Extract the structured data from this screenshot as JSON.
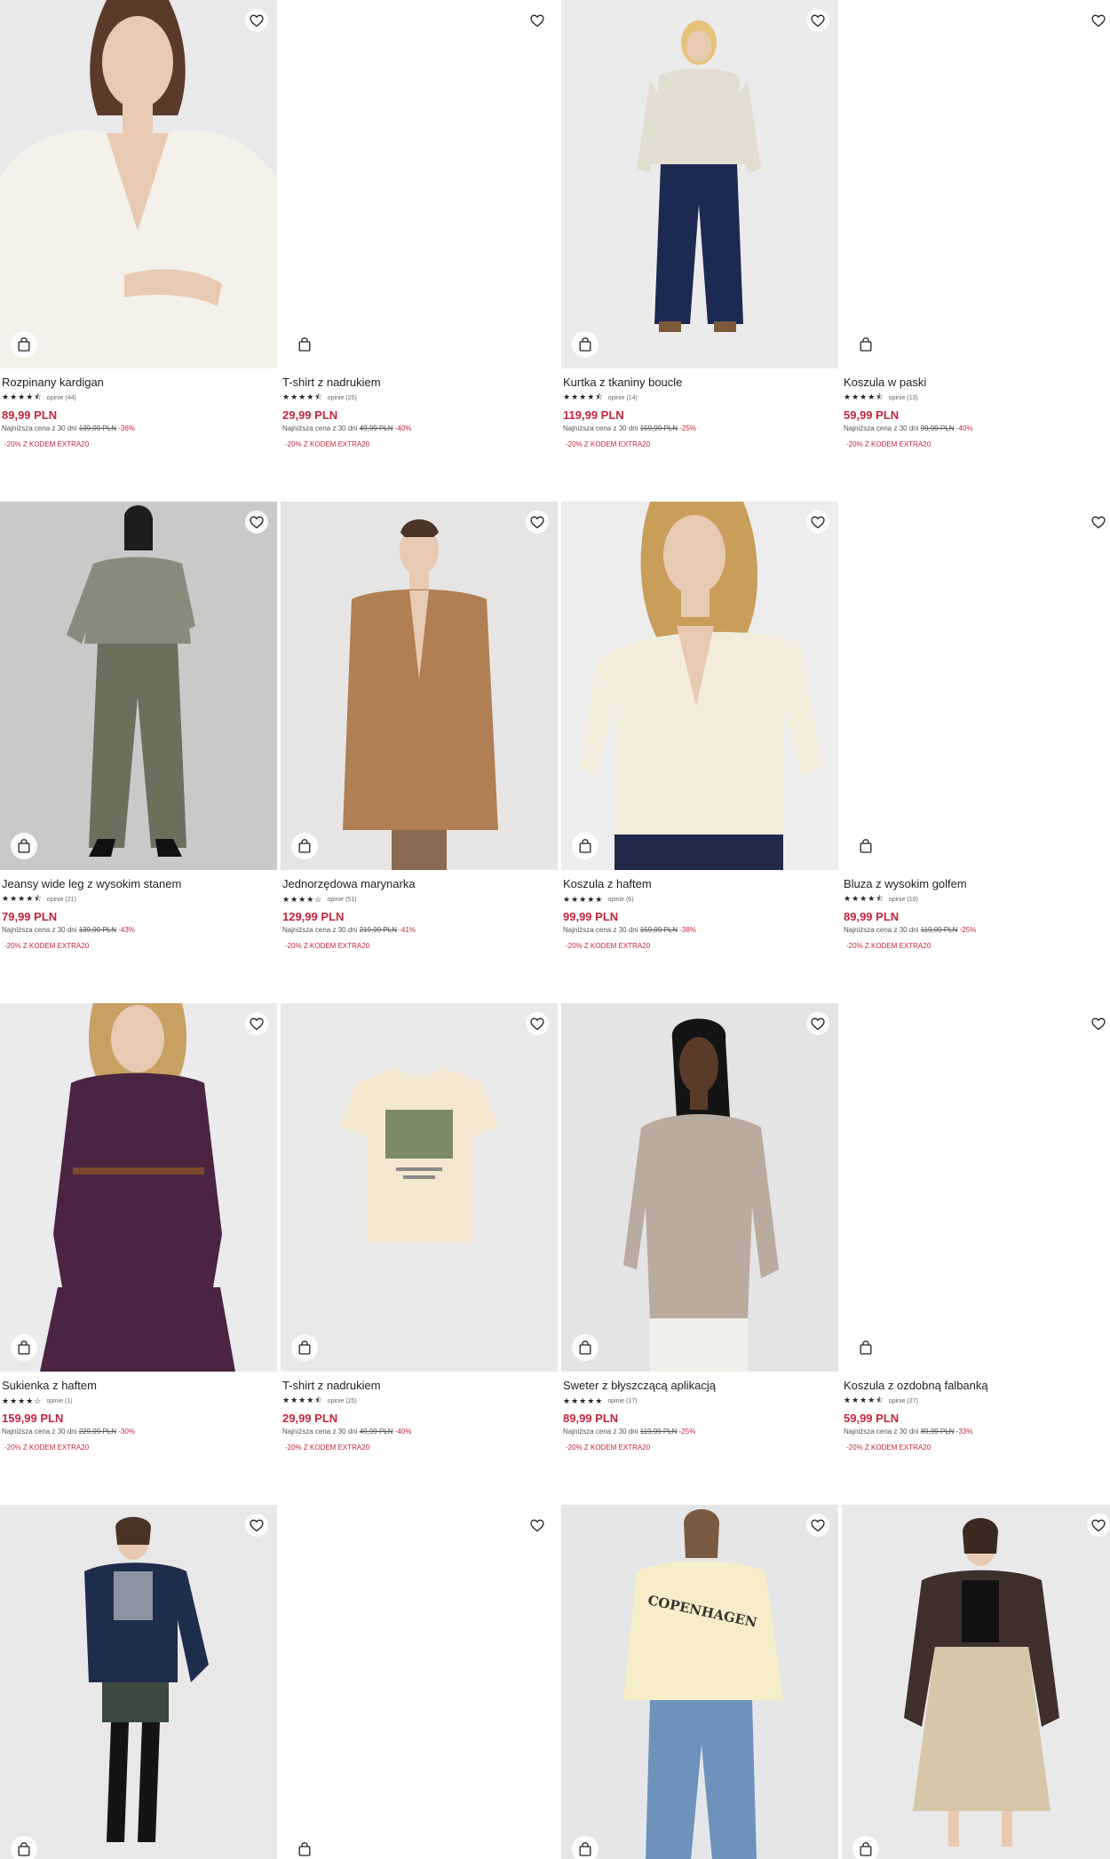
{
  "colors": {
    "price": "#c4263f",
    "text": "#222222",
    "photo_bg": "#ececed"
  },
  "icons": {
    "wishlist": "heart-outline-icon",
    "cart": "shopping-bag-icon",
    "rating": "star-icon"
  },
  "products": [
    {
      "name": "Rozpinany kardigan",
      "stars": "★★★★⯪",
      "reviews": "opinie (44)",
      "price": "89,99 PLN",
      "lowest_label": "Najniższa cena z 30 dni",
      "old_price": "139,99 PLN",
      "discount": "-36%",
      "promo": "-20% Z KODEM EXTRA20",
      "photo": "cardigan"
    },
    {
      "name": "T-shirt z nadrukiem",
      "stars": "★★★★⯪",
      "reviews": "opinie (25)",
      "price": "29,99 PLN",
      "lowest_label": "Najniższa cena z 30 dni",
      "old_price": "49,99 PLN",
      "discount": "-40%",
      "promo": "-20% Z KODEM EXTRA20",
      "photo": "blank"
    },
    {
      "name": "Kurtka z tkaniny boucle",
      "stars": "★★★★⯪",
      "reviews": "opinie (14)",
      "price": "119,99 PLN",
      "lowest_label": "Najniższa cena z 30 dni",
      "old_price": "159,99 PLN",
      "discount": "-25%",
      "promo": "-20% Z KODEM EXTRA20",
      "photo": "boucle"
    },
    {
      "name": "Koszula w paski",
      "stars": "★★★★⯪",
      "reviews": "opinie (13)",
      "price": "59,99 PLN",
      "lowest_label": "Najniższa cena z 30 dni",
      "old_price": "99,99 PLN",
      "discount": "-40%",
      "promo": "-20% Z KODEM EXTRA20",
      "photo": "blank"
    },
    {
      "name": "Jeansy wide leg z wysokim stanem",
      "stars": "★★★★⯪",
      "reviews": "opinie (21)",
      "price": "79,99 PLN",
      "lowest_label": "Najniższa cena z 30 dni",
      "old_price": "139,99 PLN",
      "discount": "-43%",
      "promo": "-20% Z KODEM EXTRA20",
      "photo": "plaid"
    },
    {
      "name": "Jednorzędowa marynarka",
      "stars": "★★★★☆",
      "reviews": "opinie (51)",
      "price": "129,99 PLN",
      "lowest_label": "Najniższa cena z 30 dni",
      "old_price": "219,99 PLN",
      "discount": "-41%",
      "promo": "-20% Z KODEM EXTRA20",
      "photo": "blazer"
    },
    {
      "name": "Koszula z haftem",
      "stars": "★★★★★",
      "reviews": "opinie (6)",
      "price": "99,99 PLN",
      "lowest_label": "Najniższa cena z 30 dni",
      "old_price": "159,99 PLN",
      "discount": "-38%",
      "promo": "-20% Z KODEM EXTRA20",
      "photo": "blouse"
    },
    {
      "name": "Bluza z wysokim golfem",
      "stars": "★★★★⯪",
      "reviews": "opinie (10)",
      "price": "89,99 PLN",
      "lowest_label": "Najniższa cena z 30 dni",
      "old_price": "119,99 PLN",
      "discount": "-25%",
      "promo": "-20% Z KODEM EXTRA20",
      "photo": "blank"
    },
    {
      "name": "Sukienka z haftem",
      "stars": "★★★★☆",
      "reviews": "opinie (1)",
      "price": "159,99 PLN",
      "lowest_label": "Najniższa cena z 30 dni",
      "old_price": "229,99 PLN",
      "discount": "-30%",
      "promo": "-20% Z KODEM EXTRA20",
      "photo": "dress"
    },
    {
      "name": "T-shirt z nadrukiem",
      "stars": "★★★★⯪",
      "reviews": "opinie (25)",
      "price": "29,99 PLN",
      "lowest_label": "Najniższa cena z 30 dni",
      "old_price": "49,99 PLN",
      "discount": "-40%",
      "promo": "-20% Z KODEM EXTRA20",
      "photo": "tshirt"
    },
    {
      "name": "Sweter z błyszczącą aplikacją",
      "stars": "★★★★★",
      "reviews": "opinie (17)",
      "price": "89,99 PLN",
      "lowest_label": "Najniższa cena z 30 dni",
      "old_price": "119,99 PLN",
      "discount": "-25%",
      "promo": "-20% Z KODEM EXTRA20",
      "photo": "sweater"
    },
    {
      "name": "Koszula z ozdobną falbanką",
      "stars": "★★★★⯪",
      "reviews": "opinie (27)",
      "price": "59,99 PLN",
      "lowest_label": "Najniższa cena z 30 dni",
      "old_price": "89,99 PLN",
      "discount": "-33%",
      "promo": "-20% Z KODEM EXTRA20",
      "photo": "blank"
    },
    {
      "photo": "navyblazer"
    },
    {
      "photo": "blank"
    },
    {
      "photo": "copenhagen",
      "print": "COPENHAGEN"
    },
    {
      "photo": "leather"
    }
  ]
}
